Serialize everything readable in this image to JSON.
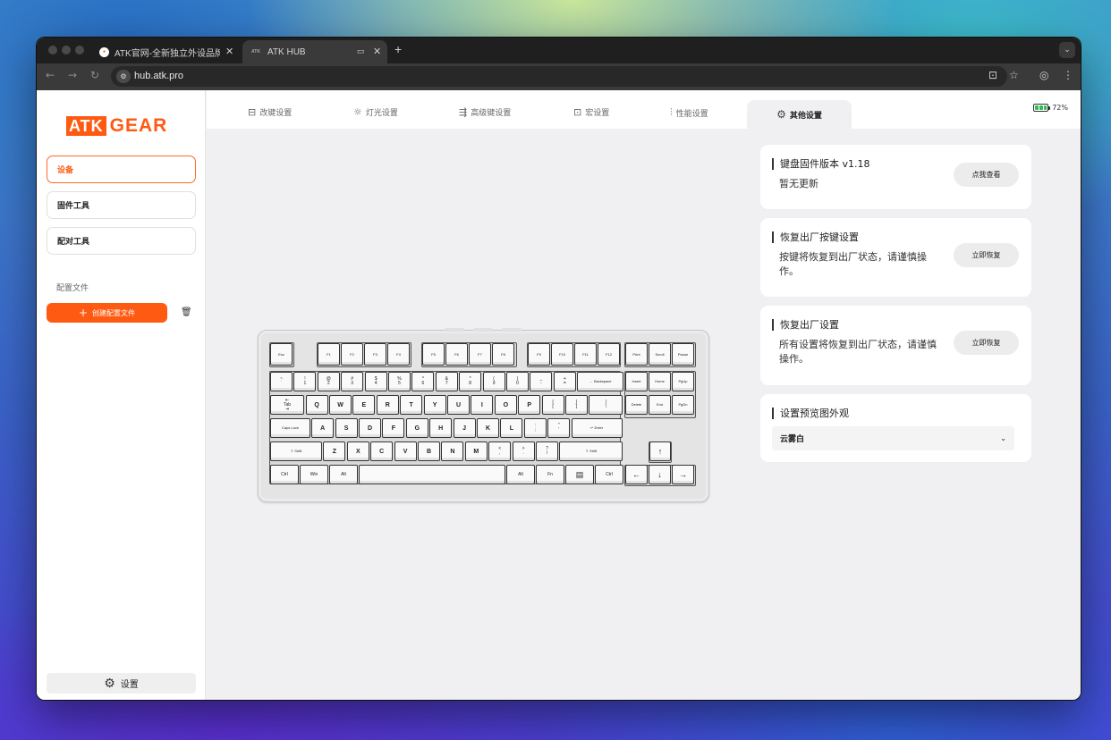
{
  "browser": {
    "tabs": [
      {
        "title": "ATK官网-全新独立外设品牌ATK",
        "favicon": "orange-logo"
      },
      {
        "title": "ATK HUB",
        "favicon": "atk-logo"
      }
    ],
    "url": "hub.atk.pro"
  },
  "sidebar": {
    "logo": {
      "part1": "ATK",
      "part2": "GEAR"
    },
    "items": [
      {
        "label": "设备",
        "active": true
      },
      {
        "label": "固件工具",
        "active": false
      },
      {
        "label": "配对工具",
        "active": false
      }
    ],
    "section_title": "配置文件",
    "create_button": "创建配置文件",
    "settings_button": "设置"
  },
  "top_tabs": [
    {
      "label": "改键设置",
      "icon": "keyboard-icon"
    },
    {
      "label": "灯光设置",
      "icon": "sun-icon"
    },
    {
      "label": "高级键设置",
      "icon": "advanced-key-icon"
    },
    {
      "label": "宏设置",
      "icon": "macro-icon"
    },
    {
      "label": "性能设置",
      "icon": "sliders-icon"
    },
    {
      "label": "其他设置",
      "icon": "gear-icon",
      "active": true
    }
  ],
  "battery": {
    "percent": "72%",
    "level": 0.72
  },
  "panels": {
    "firmware": {
      "title": "键盘固件版本 v1.18",
      "desc": "暂无更新",
      "button": "点我查看"
    },
    "reset_keys": {
      "title": "恢复出厂按键设置",
      "desc": "按键将恢复到出厂状态，请谨慎操作。",
      "button": "立即恢复"
    },
    "reset_all": {
      "title": "恢复出厂设置",
      "desc": "所有设置将恢复到出厂状态，请谨慎操作。",
      "button": "立即恢复"
    },
    "preview": {
      "title": "设置预览图外观",
      "selected": "云雾白"
    }
  },
  "keyboard": {
    "row_fn": [
      "Esc",
      "F1",
      "F2",
      "F3",
      "F4",
      "F5",
      "F6",
      "F7",
      "F8",
      "F9",
      "F10",
      "F11",
      "F12",
      "Print",
      "Scroll",
      "Pause"
    ],
    "row_num": [
      "~\n`",
      "!\n1",
      "@\n2",
      "#\n3",
      "$\n4",
      "%\n5",
      "^\n6",
      "&\n7",
      "*\n8",
      "(\n9",
      ")\n0",
      "_\n-",
      "+\n=",
      "← Backspace",
      "Insert",
      "Home",
      "PgUp"
    ],
    "row_tab": [
      "⇤\nTab\n⇥",
      "Q",
      "W",
      "E",
      "R",
      "T",
      "Y",
      "U",
      "I",
      "O",
      "P",
      "{\n[",
      "}\n]",
      "|\n\\",
      "Delete",
      "End",
      "PgDn"
    ],
    "row_caps": [
      "Caps Lock",
      "A",
      "S",
      "D",
      "F",
      "G",
      "H",
      "J",
      "K",
      "L",
      ":\n;",
      "\"\n'",
      "↵ Enter"
    ],
    "row_shift": [
      "⇧ Shift",
      "Z",
      "X",
      "C",
      "V",
      "B",
      "N",
      "M",
      "<\n,",
      ">\n.",
      "?\n/",
      "⇧ Shift",
      "↑"
    ],
    "row_bottom": [
      "Ctrl",
      "Win",
      "Alt",
      "",
      "Alt",
      "Fn",
      "▤",
      "Ctrl",
      "←",
      "↓",
      "→"
    ]
  }
}
